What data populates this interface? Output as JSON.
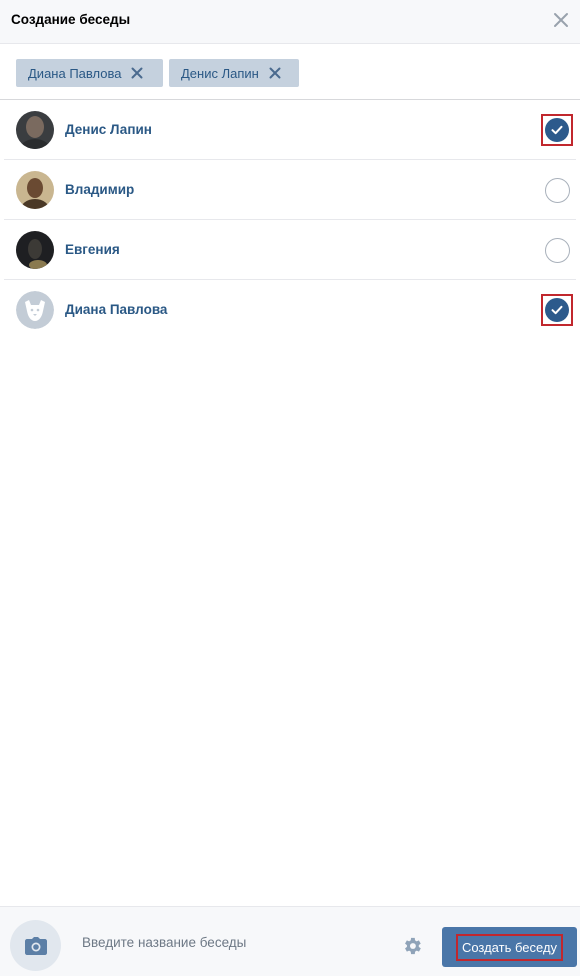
{
  "header": {
    "title": "Создание беседы",
    "close_icon": "close-icon"
  },
  "chips": [
    {
      "label": "Диана Павлова",
      "remove_icon": "close-icon"
    },
    {
      "label": "Денис Лапин",
      "remove_icon": "close-icon"
    }
  ],
  "friends": [
    {
      "name": "Денис Лапин",
      "selected": true,
      "avatar": "photo-dark"
    },
    {
      "name": "Владимир",
      "selected": false,
      "avatar": "photo-warm"
    },
    {
      "name": "Евгения",
      "selected": false,
      "avatar": "photo-night"
    },
    {
      "name": "Диана Павлова",
      "selected": true,
      "avatar": "default-dog-avatar"
    }
  ],
  "footer": {
    "photo_icon": "camera-icon",
    "title_placeholder": "Введите название беседы",
    "title_value": "",
    "settings_icon": "gear-icon",
    "create_label": "Создать беседу"
  },
  "colors": {
    "accent": "#4a76a8",
    "link": "#2a5885",
    "chip_bg": "#c5d1de",
    "check_fill": "#2c5a8c",
    "highlight": "#c1272d"
  }
}
